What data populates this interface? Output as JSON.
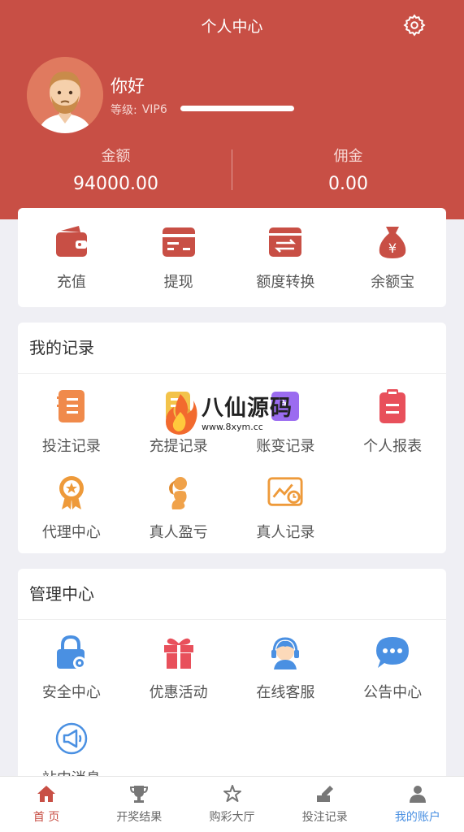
{
  "header": {
    "title": "个人中心",
    "settings_icon": "gear-icon",
    "background": "#c84f45"
  },
  "profile": {
    "greeting": "你好",
    "level_label": "等级:",
    "level_value": "VIP6",
    "level_progress": 1.0
  },
  "balances": [
    {
      "label": "金额",
      "value": "94000.00"
    },
    {
      "label": "佣金",
      "value": "0.00"
    }
  ],
  "wallet_actions": [
    {
      "label": "充值",
      "icon": "wallet-icon",
      "color": "#c84f45"
    },
    {
      "label": "提现",
      "icon": "card-icon",
      "color": "#c84f45"
    },
    {
      "label": "额度转换",
      "icon": "transfer-icon",
      "color": "#c84f45"
    },
    {
      "label": "余额宝",
      "icon": "money-bag-icon",
      "color": "#c84f45"
    }
  ],
  "records": {
    "title": "我的记录",
    "items": [
      {
        "label": "投注记录",
        "icon": "bet-record-icon",
        "color": "#f08a4b"
      },
      {
        "label": "充提记录",
        "icon": "deposit-record-icon",
        "color": "#f3c34a"
      },
      {
        "label": "账变记录",
        "icon": "ledger-icon",
        "color": "#9b6cf0"
      },
      {
        "label": "个人报表",
        "icon": "clipboard-icon",
        "color": "#e8505b"
      },
      {
        "label": "代理中心",
        "icon": "medal-icon",
        "color": "#ee9a3a"
      },
      {
        "label": "真人盈亏",
        "icon": "dealer-icon",
        "color": "#f0a24a"
      },
      {
        "label": "真人记录",
        "icon": "chart-record-icon",
        "color": "#ee9a3a"
      }
    ]
  },
  "management": {
    "title": "管理中心",
    "items": [
      {
        "label": "安全中心",
        "icon": "lock-icon",
        "color": "#4a90e2"
      },
      {
        "label": "优惠活动",
        "icon": "gift-icon",
        "color": "#e8505b"
      },
      {
        "label": "在线客服",
        "icon": "headset-icon",
        "color": "#4a90e2"
      },
      {
        "label": "公告中心",
        "icon": "chat-bubble-icon",
        "color": "#4a90e2"
      },
      {
        "label": "站内消息",
        "icon": "megaphone-icon",
        "color": "#4a90e2"
      }
    ]
  },
  "watermark": {
    "main": "八仙源码",
    "url": "www.8xym.cc"
  },
  "tabbar": [
    {
      "label": "首 页",
      "icon": "home-icon",
      "active": true
    },
    {
      "label": "开奖结果",
      "icon": "trophy-icon"
    },
    {
      "label": "购彩大厅",
      "icon": "star-icon"
    },
    {
      "label": "投注记录",
      "icon": "edit-icon"
    },
    {
      "label": "我的账户",
      "icon": "user-icon"
    }
  ]
}
